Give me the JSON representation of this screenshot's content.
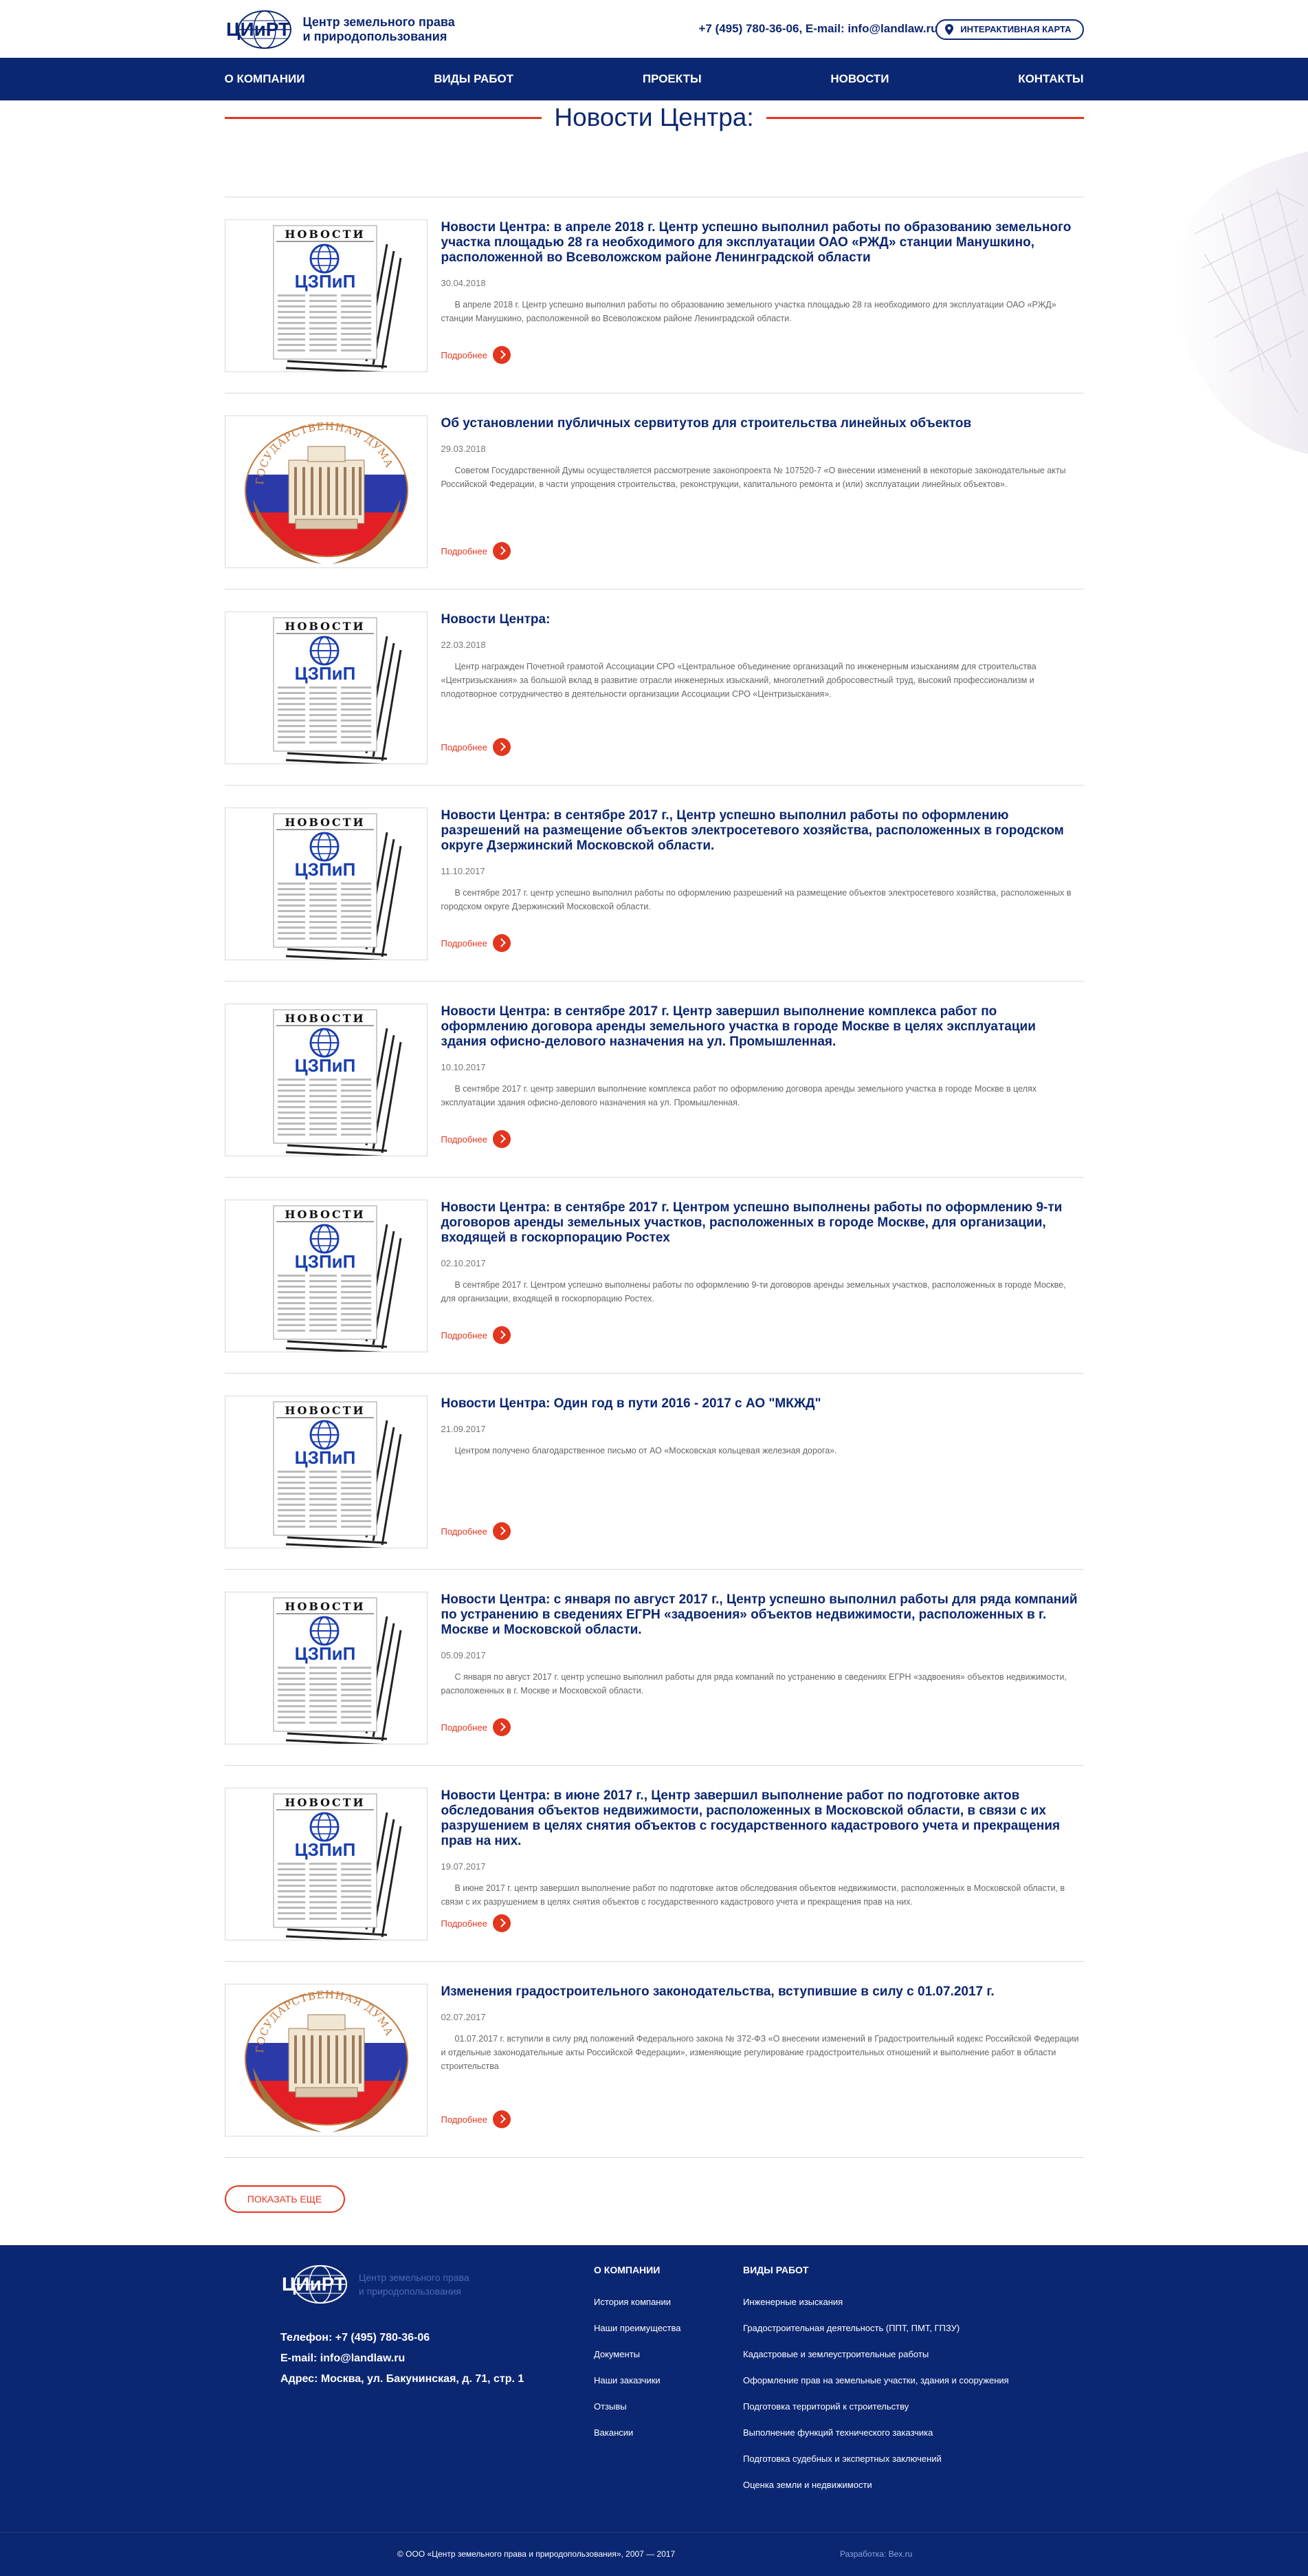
{
  "header": {
    "logo_text": "ЦИиРТ",
    "company_name_line1": "Центр земельного права",
    "company_name_line2": "и природопользования",
    "phone": "+7 (495) 780-36-06,",
    "email": "E-mail: info@landlaw.ru",
    "map_button": "Интерактивная карта"
  },
  "nav": {
    "items": [
      {
        "label": "О компании"
      },
      {
        "label": "Виды работ"
      },
      {
        "label": "Проекты"
      },
      {
        "label": "Новости"
      },
      {
        "label": "Контакты"
      }
    ]
  },
  "page_title": "Новости Центра:",
  "news": [
    {
      "image": "newspaper",
      "title": "Новости Центра: в апреле 2018 г. Центр успешно выполнил работы по образованию земельного участка площадью 28 га необходимого для эксплуатации ОАО «РЖД» станции Манушкино, расположенной во Всеволожском районе Ленинградской области",
      "date": "30.04.2018",
      "text": "В апреле 2018 г. Центр успешно выполнил работы по образованию земельного участка площадью 28 га необходимого для эксплуатации ОАО «РЖД» станции Манушкино, расположенной во Всеволожском районе Ленинградской области.",
      "more": "Подробнее"
    },
    {
      "image": "duma",
      "title": "Об установлении публичных сервитутов для строительства линейных объектов",
      "date": "29.03.2018",
      "text": "Советом Государственной Думы осуществляется рассмотрение законопроекта № 107520-7 «О внесении изменений в некоторые законодательные акты Российской Федерации, в части упрощения строительства, реконструкции, капитального ремонта и (или) эксплуатации линейных объектов».",
      "more": "Подробнее"
    },
    {
      "image": "newspaper",
      "title": "Новости Центра:",
      "date": "22.03.2018",
      "text": "Центр награжден Почетной грамотой Ассоциации СРО «Центральное объединение организаций по инженерным изысканиям для строительства «Центризыскания» за большой вклад в развитие отрасли инженерных изысканий, многолетний добросовестный труд, высокий профессионализм и плодотворное сотрудничество в деятельности организации Ассоциации СРО «Центризыскания».",
      "more": "Подробнее"
    },
    {
      "image": "newspaper",
      "title": "Новости Центра: в сентябре 2017 г., Центр успешно выполнил работы по оформлению разрешений на размещение объектов электросетевого хозяйства, расположенных в городском округе Дзержинский Московской области.",
      "date": "11.10.2017",
      "text": "В сентябре 2017 г. центр успешно выполнил работы по оформлению разрешений на размещение объектов электросетевого хозяйства, расположенных в городском округе Дзержинский Московской области.",
      "more": "Подробнее"
    },
    {
      "image": "newspaper",
      "title": "Новости Центра: в сентябре 2017 г. Центр завершил выполнение комплекса работ по оформлению договора аренды земельного участка в городе Москве в целях эксплуатации здания офисно-делового назначения на ул. Промышленная.",
      "date": "10.10.2017",
      "text": "В сентябре 2017 г. центр завершил выполнение комплекса работ по оформлению договора аренды земельного участка в городе Москве в целях эксплуатации здания офисно-делового назначения на ул. Промышленная.",
      "more": "Подробнее"
    },
    {
      "image": "newspaper",
      "title": "Новости Центра: в сентябре 2017 г. Центром успешно выполнены работы по оформлению 9-ти договоров аренды земельных участков, расположенных в городе Москве, для организации, входящей в госкорпорацию Ростех",
      "date": "02.10.2017",
      "text": "В сентябре 2017 г. Центром успешно выполнены работы по оформлению 9-ти договоров аренды земельных участков, расположенных в городе Москве, для организации, входящей в госкорпорацию Ростех.",
      "more": "Подробнее"
    },
    {
      "image": "newspaper",
      "title": "Новости Центра: Один год в пути 2016 - 2017 с АО \"МКЖД\"",
      "date": "21.09.2017",
      "text": "Центром получено благодарственное письмо от АО «Московская кольцевая железная дорога».",
      "more": "Подробнее"
    },
    {
      "image": "newspaper",
      "title": "Новости Центра: с января по август 2017 г., Центр успешно выполнил работы для ряда компаний по устранению в сведениях ЕГРН «задвоения» объектов недвижимости, расположенных в г. Москве и Московской области.",
      "date": "05.09.2017",
      "text": "С января по август 2017 г. центр успешно выполнил работы для ряда компаний по устранению в сведениях ЕГРН «задвоения» объектов недвижимости, расположенных в г. Москве и Московской области.",
      "more": "Подробнее"
    },
    {
      "image": "newspaper",
      "title": "Новости Центра: в июне 2017 г., Центр завершил выполнение работ по подготовке актов обследования объектов недвижимости, расположенных в Московской области, в связи с их разрушением в целях снятия объектов с государственного кадастрового учета и прекращения прав на них.",
      "date": "19.07.2017",
      "text": "В июне 2017 г. центр завершил выполнение работ по подготовке актов обследования объектов недвижимости, расположенных в Московской области, в связи с их разрушением в целях снятия объектов с государственного кадастрового учета и прекращения прав на них.",
      "more": "Подробнее"
    },
    {
      "image": "duma",
      "title": "Изменения градостроительного законодательства, вступившие в силу с 01.07.2017 г.",
      "date": "02.07.2017",
      "text": "01.07.2017 г. вступили в силу ряд положений Федерального закона № 372-ФЗ «О внесении изменений в Градостроительный кодекс Российской Федерации и отдельные законодательные акты Российской Федерации», изменяющие регулирование градостроительных отношений и выполнение работ в области строительства",
      "more": "Подробнее"
    }
  ],
  "newspaper_image": {
    "header": "НОВОСТИ",
    "logo": "ЦЗПиП"
  },
  "duma_image": {
    "arc_text": "ГОСУДАРСТВЕННАЯ ДУМА"
  },
  "show_more": "Показать еще",
  "footer": {
    "logo_text": "ЦИиРТ",
    "company_line1": "Центр земельного права",
    "company_line2": "и природопользования",
    "phone": "Телефон: +7 (495) 780-36-06",
    "email": "E-mail: info@landlaw.ru",
    "address": "Адрес: Москва, ул. Бакунинская, д. 71, стр. 1",
    "col1_title": "О компании",
    "col1_links": [
      {
        "label": "История компании"
      },
      {
        "label": "Наши преимущества"
      },
      {
        "label": "Документы"
      },
      {
        "label": "Наши заказчики"
      },
      {
        "label": "Отзывы"
      },
      {
        "label": "Вакансии"
      }
    ],
    "col2_title": "Виды работ",
    "col2_links": [
      {
        "label": "Инженерные изыскания"
      },
      {
        "label": "Градостроительная деятельность (ППТ, ПМТ, ГПЗУ)"
      },
      {
        "label": "Кадастровые и землеустроительные работы"
      },
      {
        "label": "Оформление прав на земельные участки, здания и сооружения"
      },
      {
        "label": "Подготовка территорий к строительству"
      },
      {
        "label": "Выполнение функций технического заказчика"
      },
      {
        "label": "Подготовка судебных и экспертных заключений"
      },
      {
        "label": "Оценка земли и недвижимости"
      }
    ],
    "copyright": "© ООО «Центр земельного права и природопользования», 2007 — 2017",
    "developer": "Разработка: Bex.ru"
  },
  "colors": {
    "brand_blue": "#0c2772",
    "accent_red": "#e2361e"
  }
}
